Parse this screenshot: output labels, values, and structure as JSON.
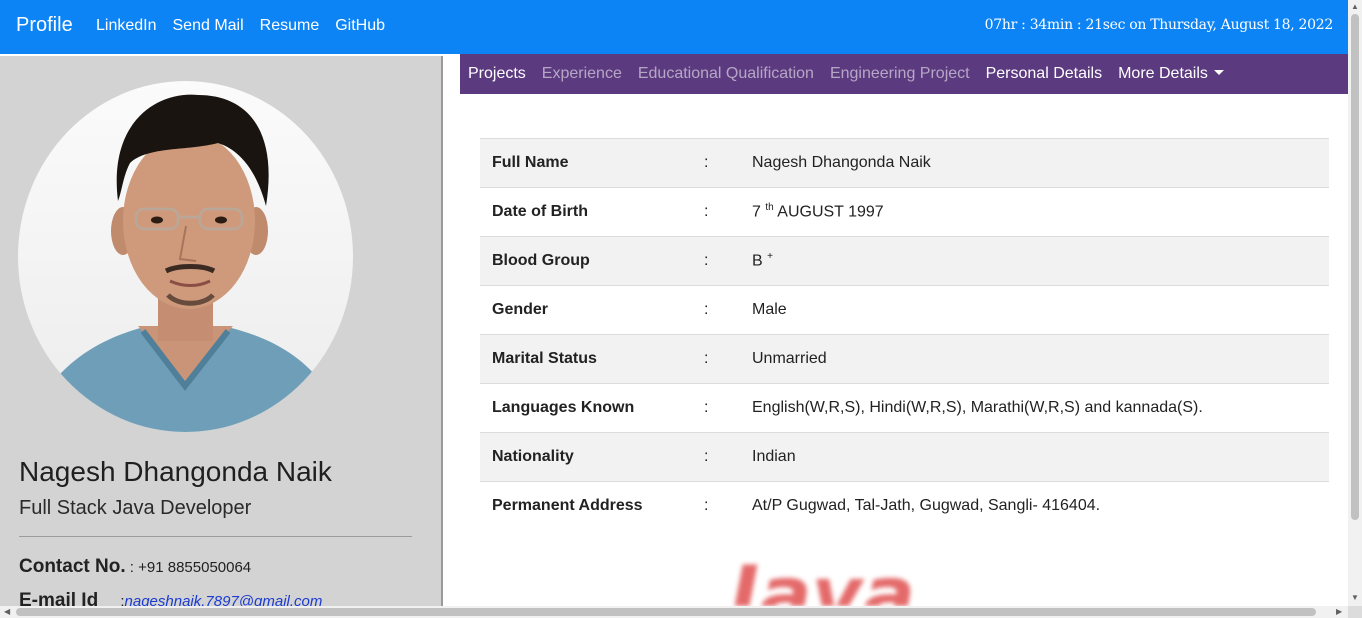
{
  "navbar": {
    "brand": "Profile",
    "links": [
      "LinkedIn",
      "Send Mail",
      "Resume",
      "GitHub"
    ],
    "clock": "07hr : 34min : 21sec on Thursday, August 18, 2022"
  },
  "profile": {
    "name": "Nagesh Dhangonda Naik",
    "role": "Full Stack Java Developer",
    "contact_label": "Contact No.",
    "contact_value": ": +91 8855050064",
    "email_label": "E-mail Id",
    "email_sep": ":",
    "email_value": "nageshnaik.7897@gmail.com"
  },
  "tabs": [
    {
      "label": "Projects",
      "state": "active"
    },
    {
      "label": "Experience",
      "state": "muted"
    },
    {
      "label": "Educational Qualification",
      "state": "muted"
    },
    {
      "label": "Engineering Project",
      "state": "muted"
    },
    {
      "label": "Personal Details",
      "state": "bright"
    },
    {
      "label": "More Details",
      "state": "bright"
    }
  ],
  "details": {
    "separator": ":",
    "rows": [
      {
        "key": "Full Name",
        "value": "Nagesh Dhangonda Naik"
      },
      {
        "key": "Date of Birth",
        "value": "7",
        "sup": "th",
        "value_after": " AUGUST 1997"
      },
      {
        "key": "Blood Group",
        "value": "B",
        "sup": "+",
        "value_after": ""
      },
      {
        "key": "Gender",
        "value": "Male"
      },
      {
        "key": "Marital Status",
        "value": "Unmarried"
      },
      {
        "key": "Languages Known",
        "value": "English(W,R,S), Hindi(W,R,S), Marathi(W,R,S) and kannada(S)."
      },
      {
        "key": "Nationality",
        "value": "Indian"
      },
      {
        "key": "Permanent Address",
        "value": "At/P Gugwad, Tal-Jath, Gugwad, Sangli- 416404."
      }
    ]
  },
  "banner_text": "Java",
  "colors": {
    "navbar": "#0d84f5",
    "tabbar": "#5c3a7f",
    "sidebar": "#d3d3d3",
    "row_stripe": "#f2f2f2",
    "email_link": "#1b3bd0"
  }
}
